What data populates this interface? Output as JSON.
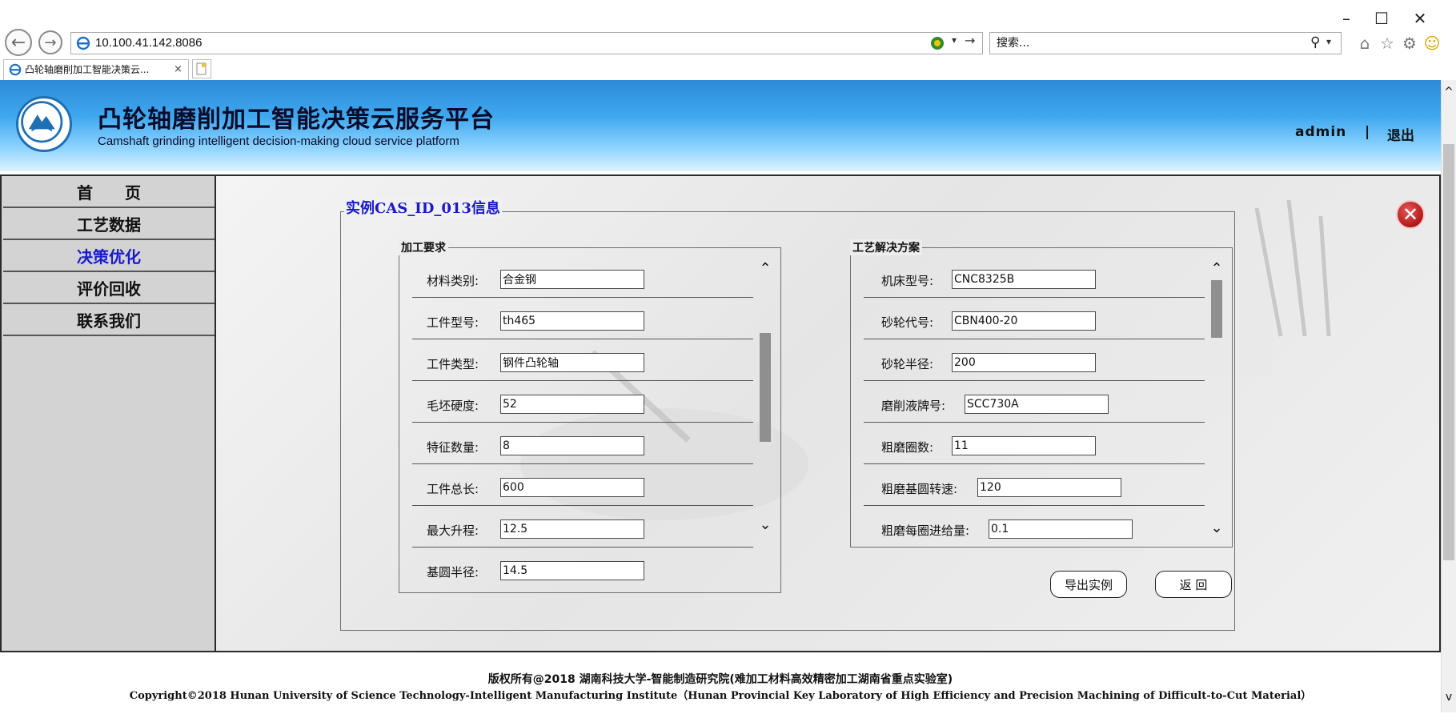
{
  "browser": {
    "address": "10.100.41.142.8086",
    "search_placeholder": "搜索...",
    "tab_title": "凸轮轴磨削加工智能决策云...",
    "tab_close": "×",
    "window_min": "–",
    "window_max": "☐",
    "window_close": "✕",
    "back_glyph": "←",
    "forward_glyph": "→",
    "search_glyph": "⚲",
    "home_glyph": "⌂",
    "star_glyph": "☆",
    "gear_glyph": "⚙",
    "smiley_glyph": "☺"
  },
  "header": {
    "title": "凸轮轴磨削加工智能决策云服务平台",
    "subtitle": "Camshaft grinding intelligent decision-making cloud service platform",
    "user": "admin",
    "separator": "|",
    "logout": "退出"
  },
  "sidebar": {
    "items": [
      {
        "label": "首　　页",
        "active": false
      },
      {
        "label": "工艺数据",
        "active": false
      },
      {
        "label": "决策优化",
        "active": true
      },
      {
        "label": "评价回收",
        "active": false
      },
      {
        "label": "联系我们",
        "active": false
      }
    ]
  },
  "panel": {
    "title": "实例CAS_ID_013信息",
    "close_glyph": "✕",
    "requirements": {
      "legend": "加工要求",
      "fields": [
        {
          "label": "材料类别:",
          "value": "合金钢"
        },
        {
          "label": "工件型号:",
          "value": "th465"
        },
        {
          "label": "工件类型:",
          "value": "钢件凸轮轴"
        },
        {
          "label": "毛坯硬度:",
          "value": "52"
        },
        {
          "label": "特征数量:",
          "value": "8"
        },
        {
          "label": "工件总长:",
          "value": "600"
        },
        {
          "label": "最大升程:",
          "value": "12.5"
        },
        {
          "label": "基圆半径:",
          "value": "14.5"
        }
      ]
    },
    "solution": {
      "legend": "工艺解决方案",
      "fields": [
        {
          "label": "机床型号:",
          "value": "CNC8325B"
        },
        {
          "label": "砂轮代号:",
          "value": "CBN400-20"
        },
        {
          "label": "砂轮半径:",
          "value": "200"
        },
        {
          "label": "磨削液牌号:",
          "value": "SCC730A"
        },
        {
          "label": "粗磨圈数:",
          "value": "11"
        },
        {
          "label": "粗磨基圆转速:",
          "value": "120"
        },
        {
          "label": "粗磨每圈进给量:",
          "value": "0.1"
        }
      ]
    },
    "scroll_up": "⌃",
    "scroll_down": "⌄",
    "export_button": "导出实例",
    "back_button": "返 回"
  },
  "footer": {
    "cn": "版权所有@2018 湖南科技大学-智能制造研究院(难加工材料高效精密加工湖南省重点实验室)",
    "en": "Copyright©2018 Hunan University of Science Technology-Intelligent Manufacturing Institute（Hunan Provincial Key Laboratory of High Efficiency and Precision Machining of Difficult-to-Cut Material）"
  },
  "colors": {
    "accent_blue": "#1a1ad0",
    "header_blue": "#3ea8ef",
    "close_red": "#b01818"
  }
}
